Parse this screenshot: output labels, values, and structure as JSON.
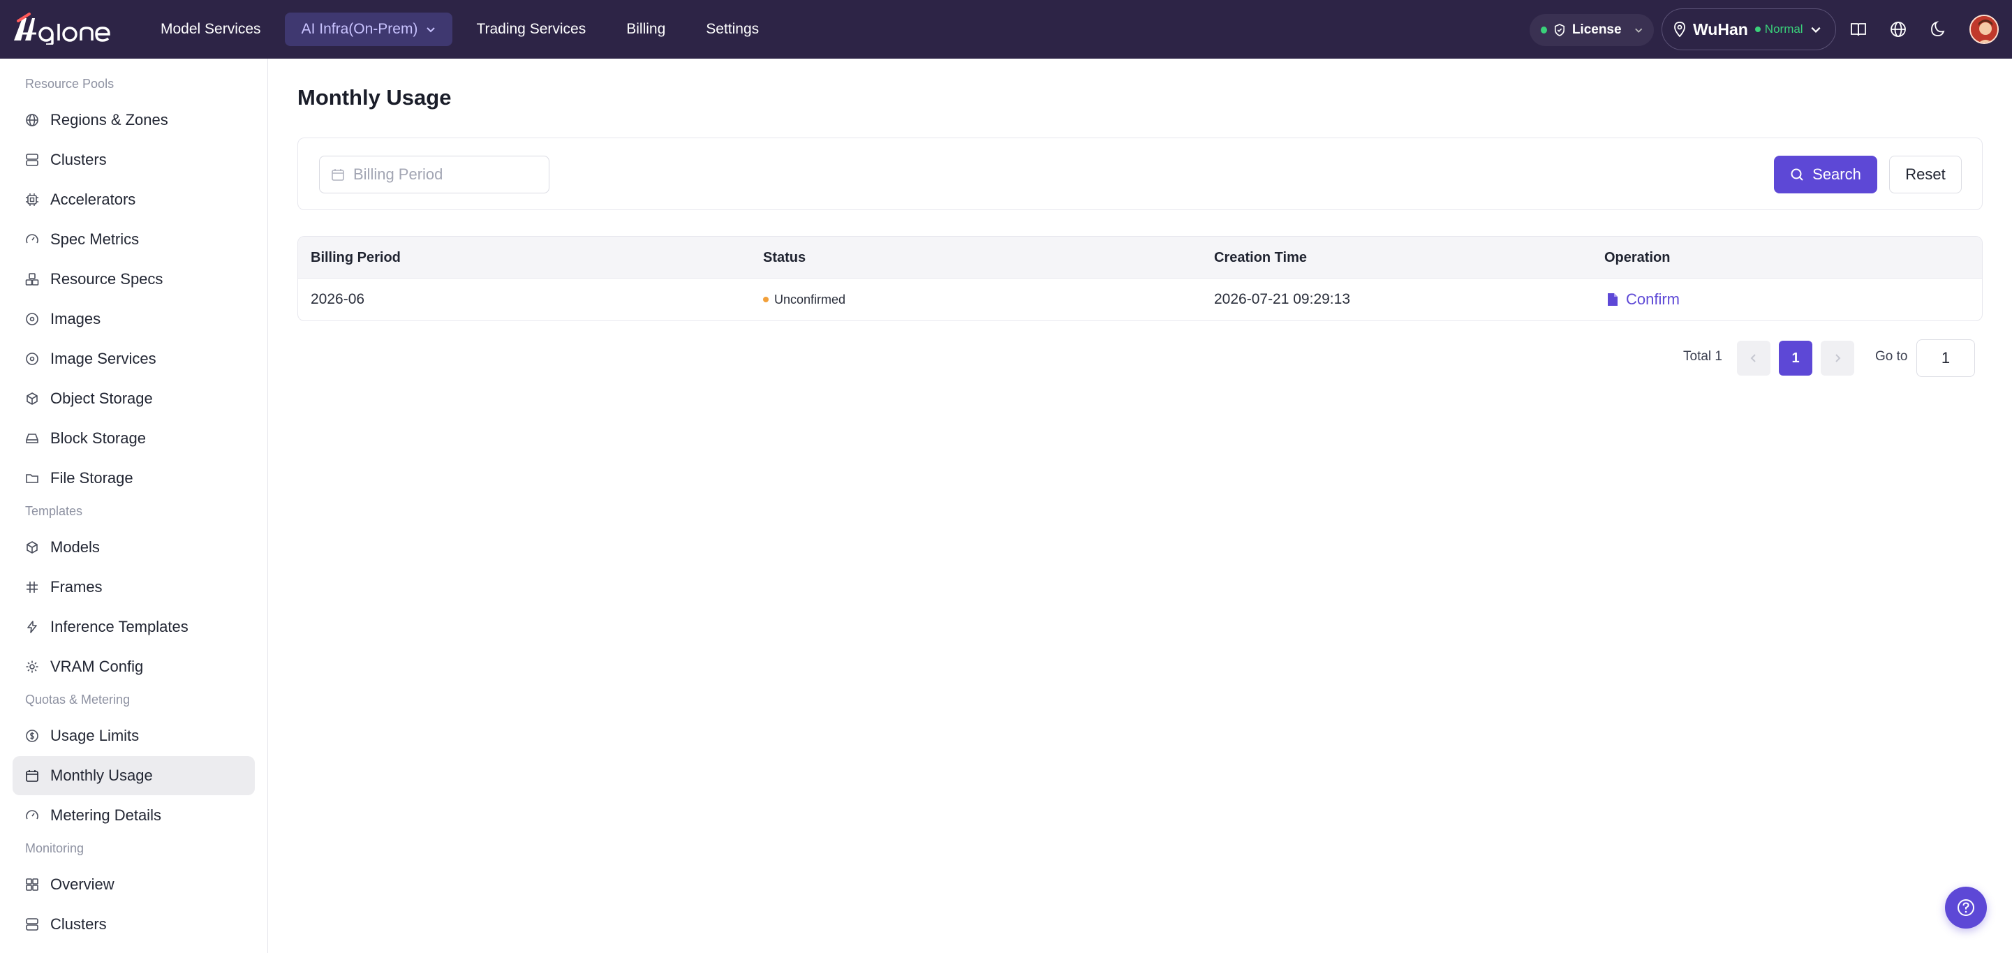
{
  "header": {
    "nav": [
      {
        "label": "Model Services",
        "active": false
      },
      {
        "label": "AI Infra(On-Prem)",
        "active": true,
        "has_dropdown": true
      },
      {
        "label": "Trading Services",
        "active": false
      },
      {
        "label": "Billing",
        "active": false
      },
      {
        "label": "Settings",
        "active": false
      }
    ],
    "license_label": "License",
    "region_name": "WuHan",
    "region_status": "Normal",
    "icons": [
      "docs-icon",
      "globe-icon",
      "moon-icon"
    ]
  },
  "sidebar": {
    "sections": [
      {
        "label": "Resource Pools",
        "items": [
          {
            "label": "Regions & Zones",
            "icon": "globe-icon"
          },
          {
            "label": "Clusters",
            "icon": "server-icon"
          },
          {
            "label": "Accelerators",
            "icon": "chip-icon"
          },
          {
            "label": "Spec Metrics",
            "icon": "gauge-icon"
          },
          {
            "label": "Resource Specs",
            "icon": "boxes-icon"
          },
          {
            "label": "Images",
            "icon": "disc-icon"
          },
          {
            "label": "Image Services",
            "icon": "disc-icon"
          },
          {
            "label": "Object Storage",
            "icon": "cube-icon"
          },
          {
            "label": "Block Storage",
            "icon": "drive-icon"
          },
          {
            "label": "File Storage",
            "icon": "folder-icon"
          }
        ]
      },
      {
        "label": "Templates",
        "items": [
          {
            "label": "Models",
            "icon": "cube-icon"
          },
          {
            "label": "Frames",
            "icon": "hash-icon"
          },
          {
            "label": "Inference Templates",
            "icon": "bolt-icon"
          },
          {
            "label": "VRAM Config",
            "icon": "gear-icon"
          }
        ]
      },
      {
        "label": "Quotas & Metering",
        "items": [
          {
            "label": "Usage Limits",
            "icon": "coin-icon"
          },
          {
            "label": "Monthly Usage",
            "icon": "calendar-icon",
            "active": true
          },
          {
            "label": "Metering Details",
            "icon": "gauge-icon"
          }
        ]
      },
      {
        "label": "Monitoring",
        "items": [
          {
            "label": "Overview",
            "icon": "grid-icon"
          },
          {
            "label": "Clusters",
            "icon": "server-icon"
          }
        ]
      }
    ]
  },
  "main": {
    "title": "Monthly Usage",
    "filter": {
      "billing_period_placeholder": "Billing Period",
      "search_label": "Search",
      "reset_label": "Reset"
    },
    "table": {
      "columns": [
        "Billing Period",
        "Status",
        "Creation Time",
        "Operation"
      ],
      "rows": [
        {
          "billing_period": "2026-06",
          "status": "Unconfirmed",
          "creation_time": "2026-07-21 09:29:13",
          "operation": "Confirm"
        }
      ]
    },
    "pagination": {
      "total_label": "Total 1",
      "current_page": "1",
      "goto_label": "Go to",
      "goto_value": "1"
    }
  },
  "colors": {
    "topbar": "#2d2446",
    "accent": "#5d48d6",
    "status_unconfirmed": "#f2a03a",
    "status_normal": "#3ad17a"
  }
}
